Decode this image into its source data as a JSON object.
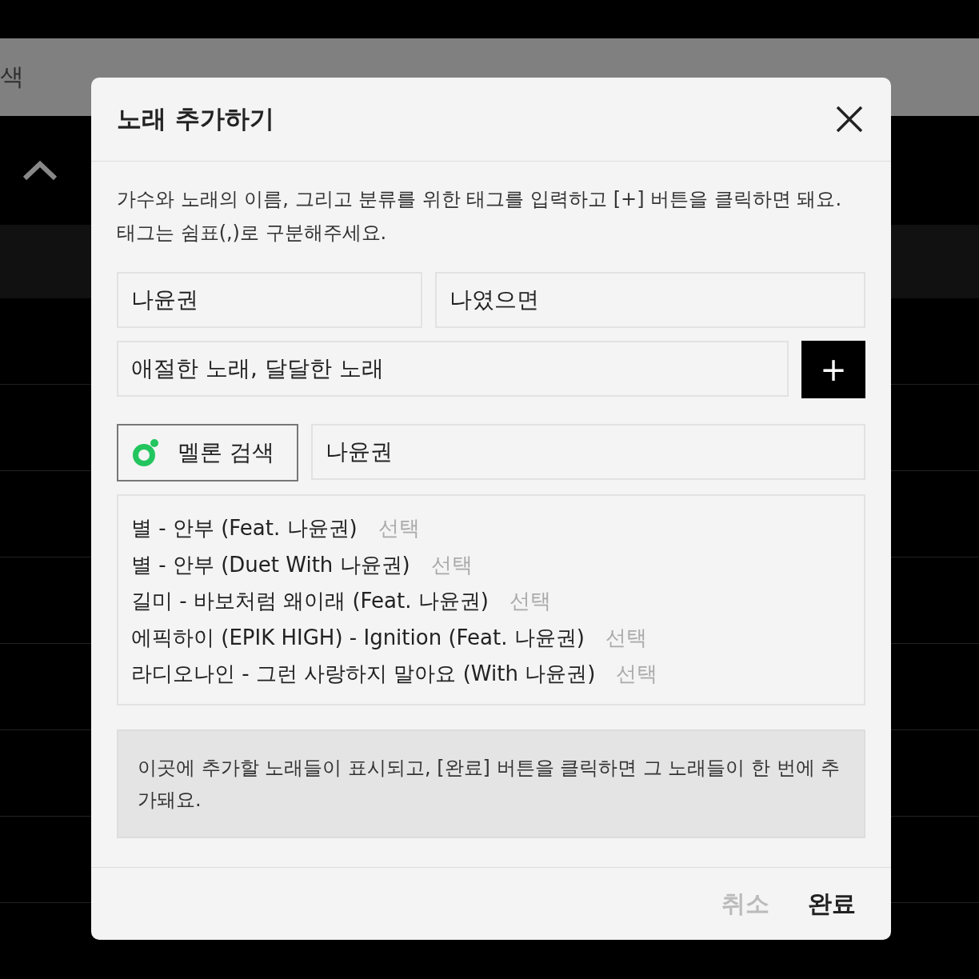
{
  "background": {
    "search_text": "색",
    "rows": [
      {
        "highlighted": true
      },
      {
        "highlighted": false
      },
      {
        "highlighted": false
      },
      {
        "highlighted": false
      },
      {
        "highlighted": false
      },
      {
        "highlighted": false
      },
      {
        "highlighted": false
      },
      {
        "highlighted": false
      }
    ]
  },
  "dialog": {
    "title": "노래 추가하기",
    "description": "가수와 노래의 이름, 그리고 분류를 위한 태그를 입력하고 [+] 버튼을 클릭하면 돼요. 태그는 쉼표(,)로 구분해주세요.",
    "artist_field": {
      "value": "나윤권"
    },
    "song_field": {
      "value": "나였으면"
    },
    "tags_field": {
      "value": "애절한 노래, 달달한 노래"
    },
    "add_button": "+",
    "melon_search_button": "멜론 검색",
    "search_field": {
      "value": "나윤권"
    },
    "results": [
      {
        "title": "별 - 안부 (Feat. 나윤권)",
        "action": "선택"
      },
      {
        "title": "별 - 안부 (Duet With 나윤권)",
        "action": "선택"
      },
      {
        "title": "길미 - 바보처럼 왜이래 (Feat. 나윤권)",
        "action": "선택"
      },
      {
        "title": "에픽하이 (EPIK HIGH) - Ignition (Feat. 나윤권)",
        "action": "선택"
      },
      {
        "title": "라디오나인 - 그런 사랑하지 말아요 (With 나윤권)",
        "action": "선택"
      }
    ],
    "info": "이곳에 추가할 노래들이 표시되고, [완료] 버튼을 클릭하면 그 노래들이 한 번에 추가돼요.",
    "buttons": [
      {
        "label": "취소",
        "kind": "cancel"
      },
      {
        "label": "완료",
        "kind": "confirm"
      }
    ]
  }
}
